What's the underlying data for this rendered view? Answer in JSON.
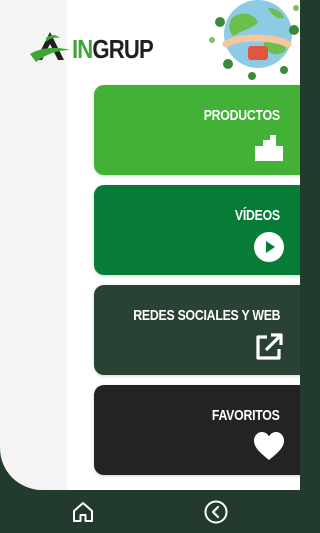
{
  "app": {
    "logo_in": "IN",
    "logo_grup": "GRUP"
  },
  "menu": [
    {
      "label": "PRODUCTOS",
      "icon": "factory-icon",
      "color": "#43b038"
    },
    {
      "label": "VÍDEOS",
      "icon": "play-circle-icon",
      "color": "#077c36"
    },
    {
      "label": "REDES SOCIALES Y WEB",
      "icon": "external-link-icon",
      "color": "#2a4234"
    },
    {
      "label": "FAVORITOS",
      "icon": "heart-icon",
      "color": "#232323"
    }
  ],
  "bottom_nav": [
    {
      "icon": "home-icon"
    },
    {
      "icon": "back-circle-icon"
    }
  ],
  "colors": {
    "brand_green": "#3fa535",
    "nav_background": "#223b2c"
  }
}
